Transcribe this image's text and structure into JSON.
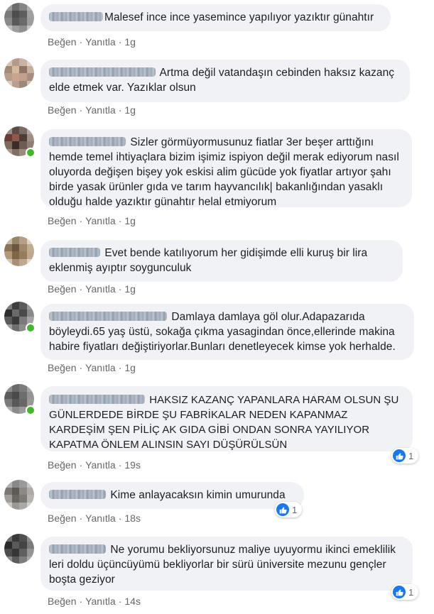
{
  "action_labels": {
    "like": "Beğen",
    "reply": "Yanıtla",
    "separator": "·"
  },
  "colors": {
    "bubble": "#f0f2f5",
    "link": "#65676b",
    "like": "#1877f2",
    "online": "#42b72a"
  },
  "comments": [
    {
      "text": "Malesef ince ince yasemince yapılıyor yazıktır günahtır",
      "time": "1g",
      "reactions": null
    },
    {
      "text": "Artma değil vatandaşın cebinden haksız kazanç elde etmek var. Yazıklar olsun",
      "time": "1g",
      "reactions": null
    },
    {
      "text": "Sizler görmüyormusunuz fiatlar 3er beşer arttığını hemde temel ihtiyaçlara bizim işimiz ispiyon değil merak ediyorum nasıl oluyorda değişen bişey yok eskisi alim gücüde yok fiyatlar artıyor şahı birde yasak ürünler gıda ve tarım hayvancılık| bakanlığından yasaklı olduğu halde yazıktır günahtır helal etmiyorum",
      "time": "1g",
      "reactions": null
    },
    {
      "text": "Evet bende katılıyorum her gidişimde elli kuruş bir lira eklenmiş ayıptır soygunculuk",
      "time": "1g",
      "reactions": null
    },
    {
      "text": "Damlaya damlaya göl olur.Adapazarıda böyleydi.65 yaş üstü, sokağa çıkma yasagindan önce,ellerinde makina habire fiyatları değiştiriyorlar.Bunları denetleyecek kimse yok herhalde.",
      "time": "1g",
      "reactions": null
    },
    {
      "text": "HAKSIZ KAZANÇ YAPANLARA HARAM OLSUN ŞU GÜNLERDEDE BİRDE ŞU FABRİKALAR NEDEN KAPANMAZ KARDEŞİM ŞEN PİLİÇ AK GIDA GİBİ ONDAN SONRA YAYILIYOR KAPATMA ÖNLEM ALINSIN SAYI DÜŞÜRÜLSÜN",
      "time": "19s",
      "reactions": "1"
    },
    {
      "text": "Kime anlayacaksın kimin umurunda",
      "time": "18s",
      "reactions": "1"
    },
    {
      "text": "Ne yorumu bekliyorsunuz maliye uyuyormu ikinci emeklilik leri doldu üçüncüyümü bekliyorlar bir sürü üniversite mezunu gençler boşta geziyor",
      "time": "14s",
      "reactions": "1"
    }
  ]
}
